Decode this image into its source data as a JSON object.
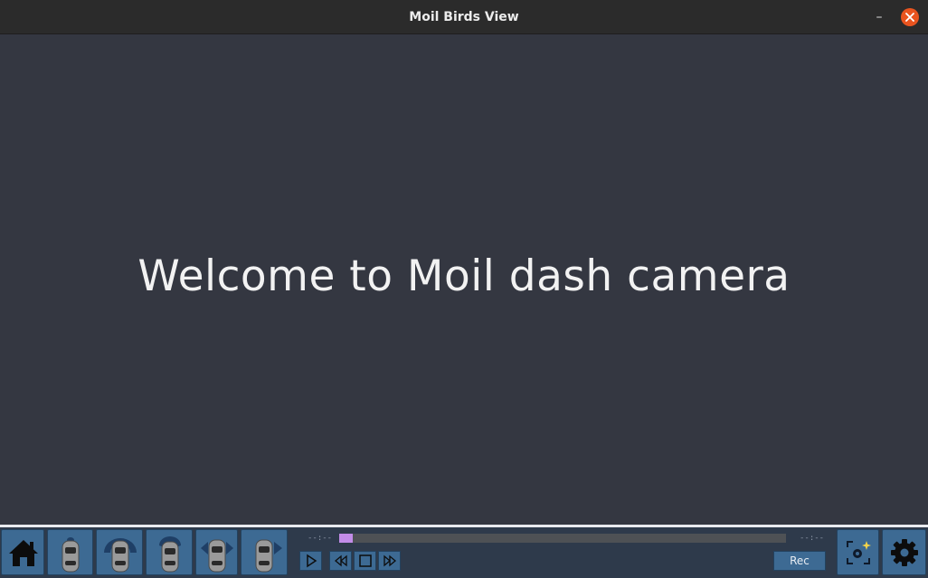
{
  "window": {
    "title": "Moil Birds View",
    "minimize_symbol": "–"
  },
  "main": {
    "welcome_text": "Welcome to Moil dash camera"
  },
  "toolbar": {
    "view_buttons": [
      {
        "name": "home-button",
        "icon": "home-icon"
      },
      {
        "name": "car-view-original-button",
        "icon": "car-icon"
      },
      {
        "name": "car-view-front-wide-button",
        "icon": "car-front-wide-icon"
      },
      {
        "name": "car-view-front-button",
        "icon": "car-front-icon"
      },
      {
        "name": "car-view-sides-button",
        "icon": "car-sides-icon"
      },
      {
        "name": "car-view-right-button",
        "icon": "car-right-icon"
      }
    ],
    "player": {
      "time_current": "--:--",
      "time_total": "--:--",
      "progress": 0.0,
      "controls": [
        "play-icon",
        "rewind-icon",
        "stop-icon",
        "fast-forward-icon"
      ],
      "rec_label": "Rec"
    },
    "right_buttons": [
      {
        "name": "camera-snapshot-button",
        "icon": "camera-sparkle-icon"
      },
      {
        "name": "settings-button",
        "icon": "gear-icon"
      }
    ]
  },
  "colors": {
    "background": "#343741",
    "button": "#3d6a93",
    "progress_handle": "#c28ce8",
    "close_button": "#e9541f"
  }
}
